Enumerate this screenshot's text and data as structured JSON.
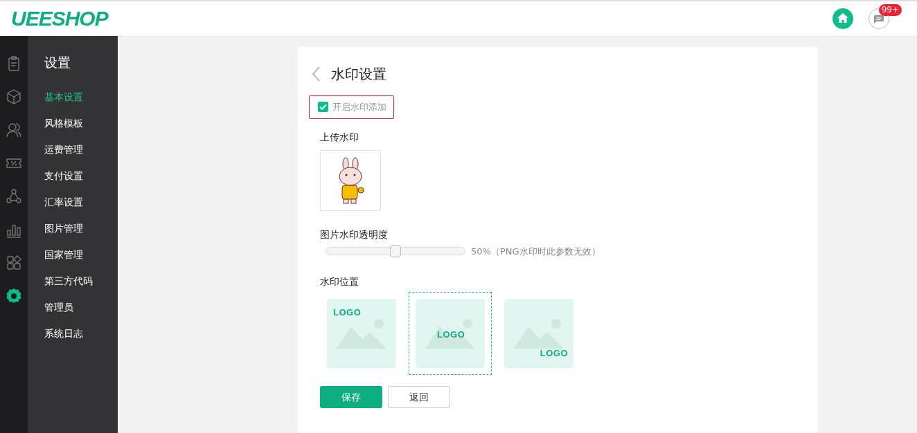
{
  "header": {
    "logo": "UEESHOP",
    "notification_count": "99+"
  },
  "rail": [
    {
      "selected": false
    },
    {
      "selected": false
    },
    {
      "selected": false
    },
    {
      "selected": false
    },
    {
      "selected": false
    },
    {
      "selected": false
    },
    {
      "selected": false
    },
    {
      "selected": true
    }
  ],
  "sidebar": {
    "title": "设置",
    "items": [
      {
        "label": "基本设置",
        "selected": true
      },
      {
        "label": "风格模板",
        "selected": false
      },
      {
        "label": "运费管理",
        "selected": false
      },
      {
        "label": "支付设置",
        "selected": false
      },
      {
        "label": "汇率设置",
        "selected": false
      },
      {
        "label": "图片管理",
        "selected": false
      },
      {
        "label": "国家管理",
        "selected": false
      },
      {
        "label": "第三方代码",
        "selected": false
      },
      {
        "label": "管理员",
        "selected": false
      },
      {
        "label": "系统日志",
        "selected": false
      }
    ]
  },
  "page": {
    "title": "水印设置",
    "enable": {
      "label": "开启水印添加",
      "checked": true
    },
    "upload_label": "上传水印",
    "opacity": {
      "label": "图片水印透明度",
      "level": 0.5,
      "reading": "50%（PNG水印时此参数无效）"
    },
    "position_label": "水印位置",
    "positions": [
      {
        "kind": "top-left",
        "text": "LOGO",
        "selected": false
      },
      {
        "kind": "center",
        "text": "LOGO",
        "selected": true
      },
      {
        "kind": "bottom-right",
        "text": "LOGO",
        "selected": false
      }
    ],
    "buttons": [
      {
        "kind": "primary",
        "label": "保存"
      },
      {
        "kind": "secondary",
        "label": "返回"
      }
    ]
  }
}
